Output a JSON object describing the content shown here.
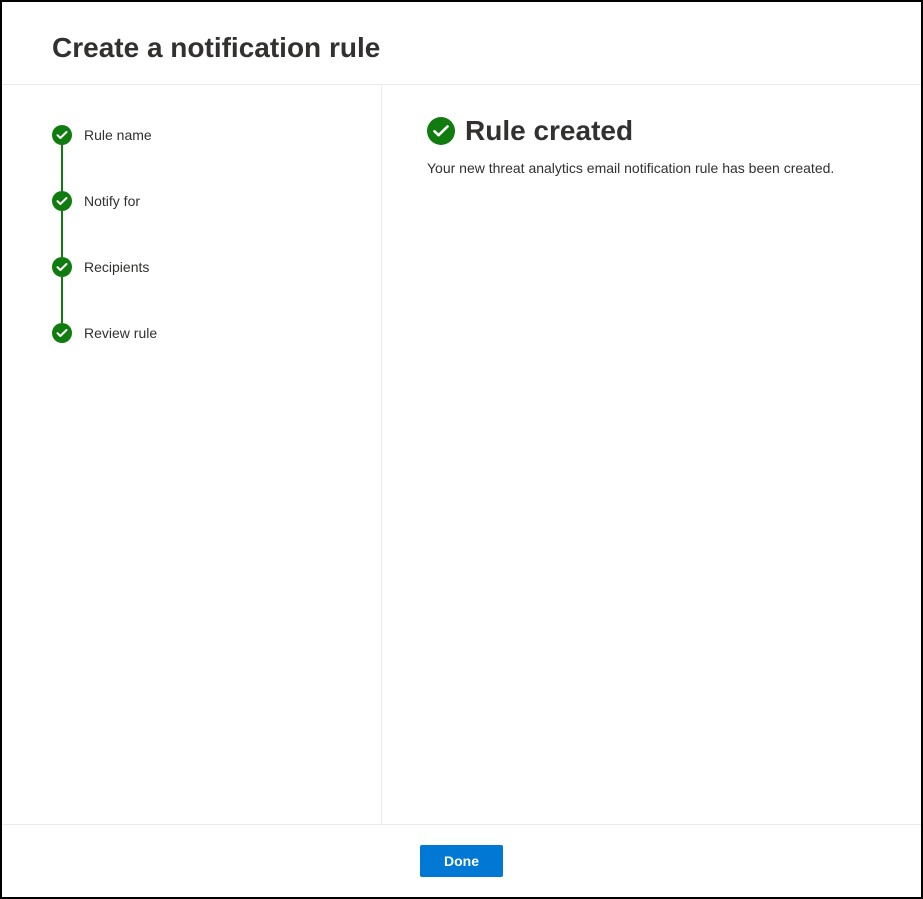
{
  "dialog": {
    "title": "Create a notification rule"
  },
  "sidebar": {
    "steps": [
      {
        "label": "Rule name",
        "completed": true
      },
      {
        "label": "Notify for",
        "completed": true
      },
      {
        "label": "Recipients",
        "completed": true
      },
      {
        "label": "Review rule",
        "completed": true
      }
    ]
  },
  "main": {
    "result_title": "Rule created",
    "result_description": "Your new threat analytics email notification rule has been created."
  },
  "footer": {
    "done_label": "Done"
  },
  "colors": {
    "success_green": "#107c10",
    "primary_blue": "#0078d4"
  }
}
